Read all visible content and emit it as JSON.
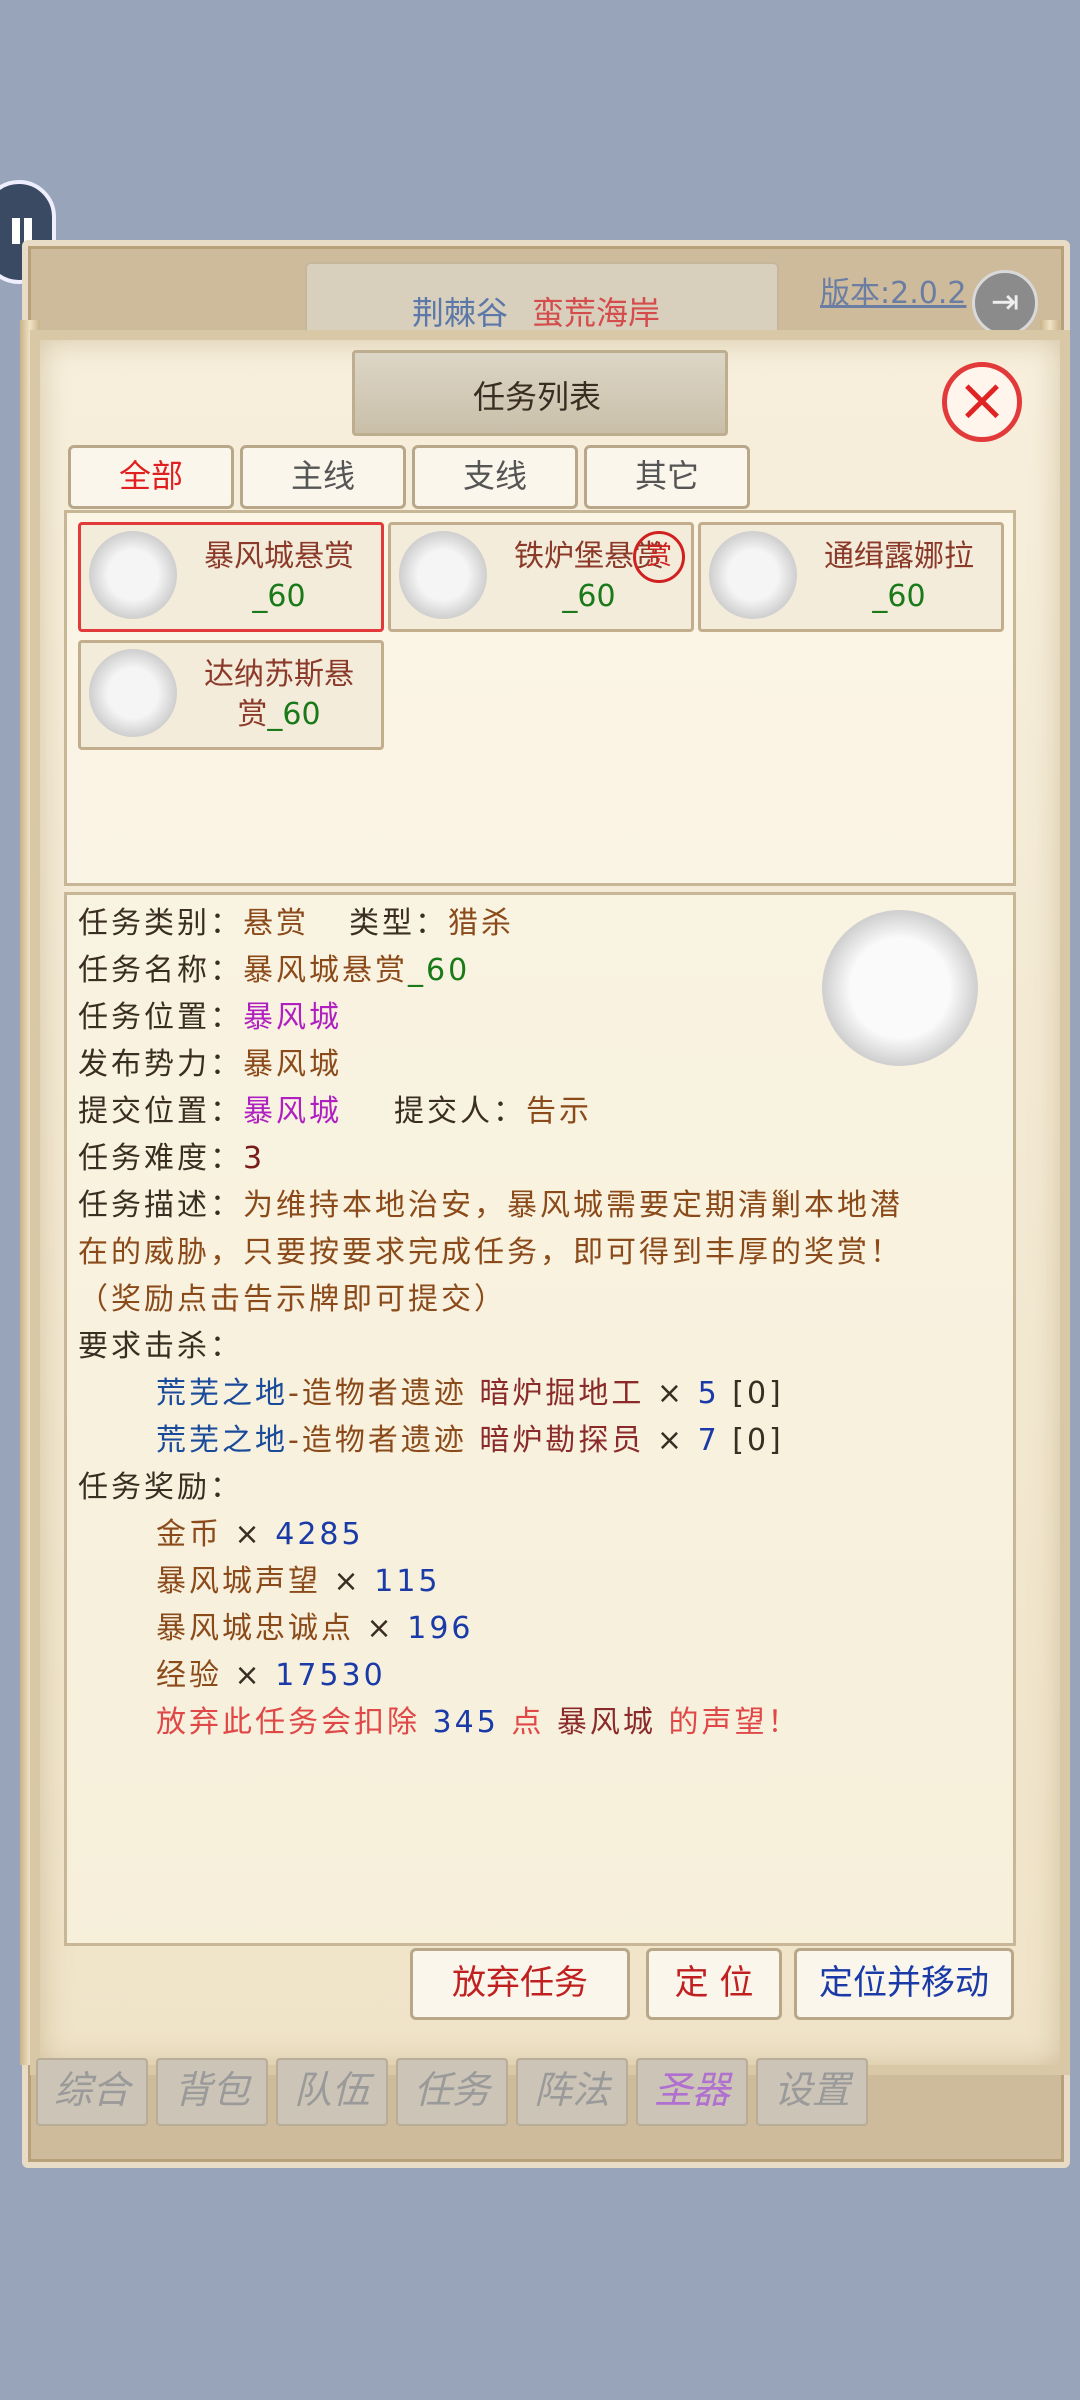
{
  "header": {
    "locations": [
      "荆棘谷",
      "蛮荒海岸"
    ],
    "version": "版本:2.0.2"
  },
  "dialog": {
    "title": "任务列表",
    "tabs": [
      "全部",
      "主线",
      "支线",
      "其它"
    ],
    "active_tab": "全部"
  },
  "quests": [
    {
      "name": "暴风城悬赏",
      "level": "_60",
      "selected": true
    },
    {
      "name": "铁炉堡悬赏",
      "level": "_60",
      "stamp": "赏"
    },
    {
      "name": "通缉露娜拉",
      "level": "_60"
    },
    {
      "name": "达纳苏斯悬",
      "name2": "赏",
      "level": "_60"
    }
  ],
  "detail": {
    "category_label": "任务类别：",
    "category_value": "悬赏",
    "type_label": "类型：",
    "type_value": "猎杀",
    "name_label": "任务名称：",
    "name_value": "暴风城悬赏",
    "name_suffix": "_60",
    "position_label": "任务位置：",
    "position_value": "暴风城",
    "faction_label": "发布势力：",
    "faction_value": "暴风城",
    "submit_label": "提交位置：",
    "submit_value": "暴风城",
    "submitter_label": "提交人：",
    "submitter_value": "告示",
    "difficulty_label": "任务难度：",
    "difficulty_value": "3",
    "desc_label": "任务描述：",
    "desc_line1": "为维持本地治安，暴风城需要定期清剿本地潜",
    "desc_line2": "在的威胁，只要按要求完成任务，即可得到丰厚的奖赏！",
    "desc_line3": "（奖励点击告示牌即可提交）",
    "kill_label": "要求击杀：",
    "kills": [
      {
        "zone": "荒芜之地",
        "sep": "-",
        "area": "造物者遗迹",
        "target": "暗炉掘地工",
        "times": "×",
        "count": "5",
        "progress": "[0]"
      },
      {
        "zone": "荒芜之地",
        "sep": "-",
        "area": "造物者遗迹",
        "target": "暗炉勘探员",
        "times": "×",
        "count": "7",
        "progress": "[0]"
      }
    ],
    "reward_label": "任务奖励：",
    "rewards": [
      {
        "name": "金币",
        "times": "×",
        "value": "4285"
      },
      {
        "name": "暴风城声望",
        "times": "×",
        "value": "115"
      },
      {
        "name": "暴风城忠诚点",
        "times": "×",
        "value": "196"
      },
      {
        "name": "经验",
        "times": "×",
        "value": "17530"
      }
    ],
    "warning_prefix": "放弃此任务会扣除",
    "warning_points": "345",
    "warning_unit": "点",
    "warning_faction": "暴风城",
    "warning_suffix": "的声望！"
  },
  "actions": {
    "abandon": "放弃任务",
    "locate": "定 位",
    "locate_move": "定位并移动"
  },
  "nav": [
    "综合",
    "背包",
    "队伍",
    "任务",
    "阵法",
    "圣器",
    "设置"
  ],
  "colors": {
    "accent_red": "#e02020",
    "brown_text": "#8b3a2a",
    "green_text": "#1a7a1a",
    "purple_text": "#b020c0",
    "blue_text": "#1a3aa8"
  }
}
